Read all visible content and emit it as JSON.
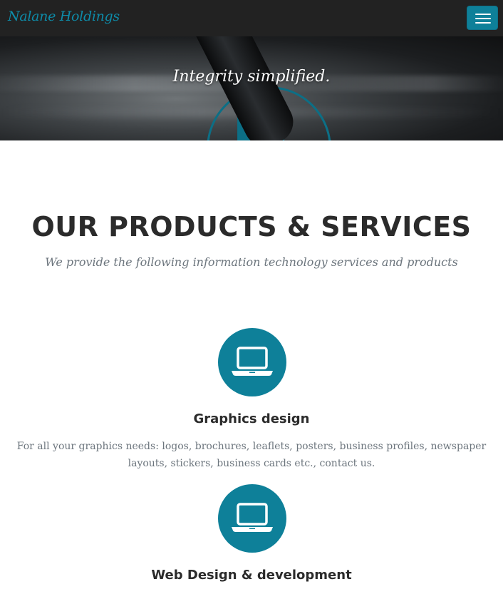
{
  "nav": {
    "brand": "Nalane Holdings",
    "toggle_icon": "hamburger-menu-icon"
  },
  "hero": {
    "tagline": "Integrity simplified."
  },
  "section": {
    "title": "OUR PRODUCTS & SERVICES",
    "subtitle": "We provide the following information technology services and products"
  },
  "services": [
    {
      "icon": "laptop-icon",
      "title": "Graphics design",
      "description": "For all your graphics needs: logos, brochures, leaflets, posters, business profiles, newspaper layouts, stickers, business cards etc., contact us."
    },
    {
      "icon": "laptop-icon",
      "title": "Web Design & development"
    }
  ],
  "colors": {
    "navbar": "#222222",
    "brand": "#0e8ba8",
    "accent": "#0e8099",
    "heading": "#2b2b2b",
    "muted": "#6c757d"
  }
}
